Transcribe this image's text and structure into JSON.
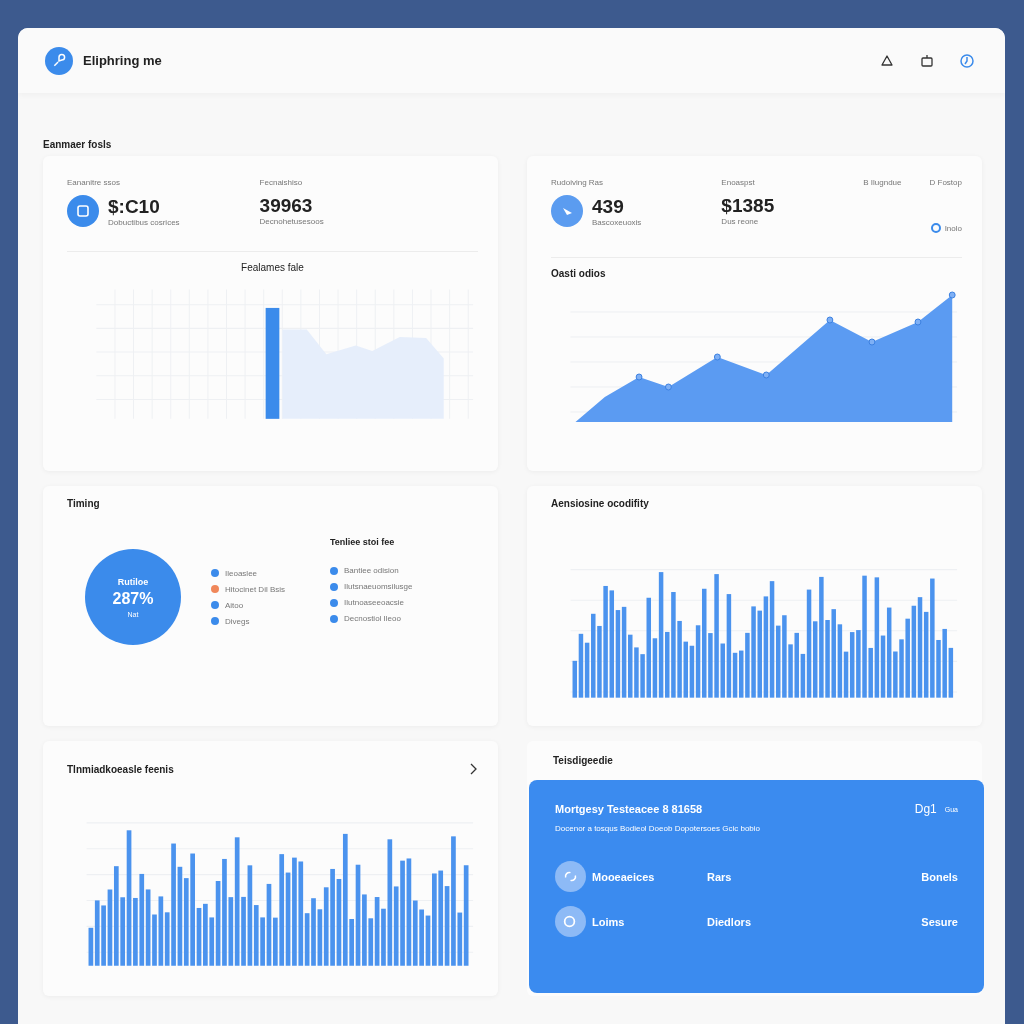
{
  "header": {
    "title": "Eliphring me"
  },
  "section_title": "Eanmaer fosls",
  "overview": {
    "stats": [
      {
        "label": "Eananitre ssos",
        "value": "$:C10",
        "sub": "Dobuctibus cosrices"
      },
      {
        "label": "Fecnaishiso",
        "value": "39963",
        "sub": "Decnohetusesoos"
      }
    ],
    "chart_title": "Fealames fale"
  },
  "revenue": {
    "stats": [
      {
        "label": "Rudoiving Ras",
        "value": "439",
        "sub": "Bascoxeuoxis"
      },
      {
        "label": "Enoaspst",
        "value": "$1385",
        "sub": "Dus reone"
      }
    ],
    "legend": [
      {
        "label": "B  Ilugndue"
      },
      {
        "label": "D  Fostop"
      }
    ],
    "option": {
      "label": "Inolo",
      "selected": true
    },
    "chart_title": "Oasti odios"
  },
  "timing": {
    "title": "Timing",
    "donut": {
      "label": "Rutiloe",
      "value": "287%",
      "sub": "Nat"
    },
    "legend": [
      {
        "label": "Ileoaslee",
        "color": "#3b8beb"
      },
      {
        "label": "Hitocinet Dil Bsis",
        "color": "#f0875a"
      },
      {
        "label": "Aitoo",
        "color": "#3b8beb"
      },
      {
        "label": "Divegs",
        "color": "#3b8beb"
      }
    ],
    "right_title": "Tenliee stoi fee",
    "right_legend": [
      {
        "label": "Bantiee odision",
        "color": "#3b8beb"
      },
      {
        "label": "Ilutsnaeuomsilusge",
        "color": "#3b8beb"
      },
      {
        "label": "Ilutnoaseeoacsie",
        "color": "#3b8beb"
      },
      {
        "label": "Decnostiol Ileoo",
        "color": "#3b8beb"
      }
    ]
  },
  "activity": {
    "title": "Aensiosine ocodifity"
  },
  "trends": {
    "title": "Tlnmiadkoeasle feenis"
  },
  "summary": {
    "title": "Teisdigeedie",
    "card_title": "Mortgesy Testeacee 8 81658",
    "badge": "Dg1",
    "badge_note": "Gua",
    "subtitle": "Docenor a tosqus Bodieol Doeob Dopotersoes Gcic bobio",
    "rows": [
      {
        "name": "Mooeaeices",
        "col2": "Rars",
        "col3": "Bonels"
      },
      {
        "name": "Loims",
        "col2": "Diedlors",
        "col3": "Sesure"
      }
    ]
  }
}
